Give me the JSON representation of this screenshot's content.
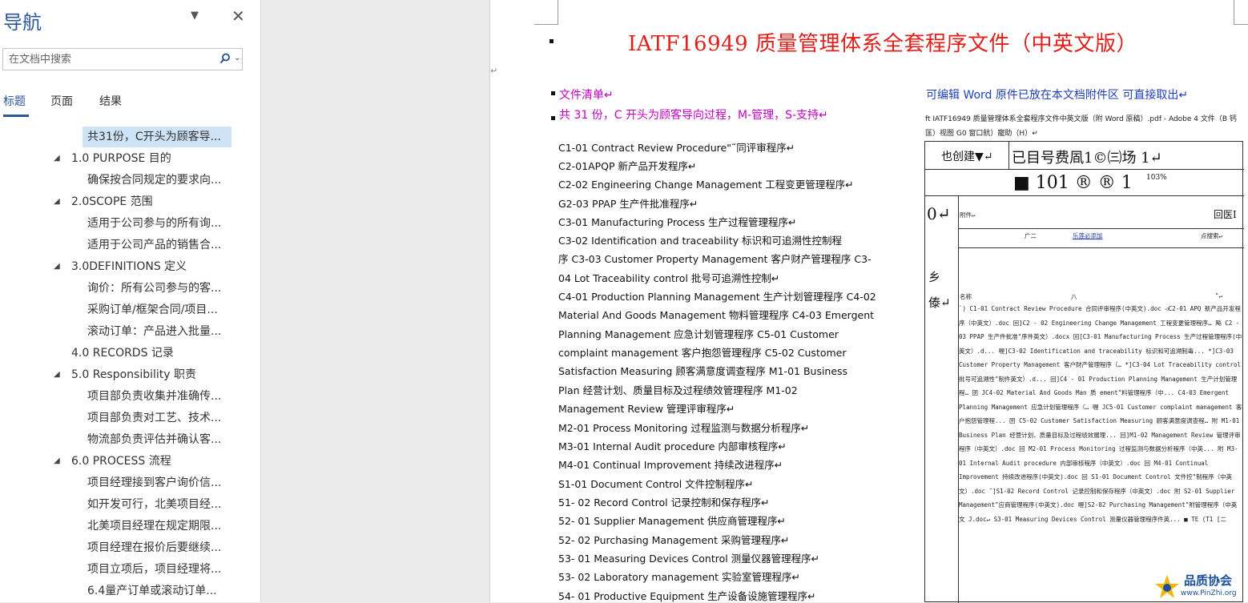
{
  "nav": {
    "title": "导航",
    "menu_icon": "triangle-down-icon",
    "close_icon": "close-icon",
    "search_placeholder": "在文档中搜索",
    "tabs": [
      "标题",
      "页面",
      "结果"
    ],
    "tree": [
      {
        "text": "共31份，C开头为顾客导...",
        "level": 2,
        "selected": true
      },
      {
        "text": "1.0 PURPOSE 目的",
        "level": 1,
        "expanded": true
      },
      {
        "text": "确保按合同规定的要求向...",
        "level": 2
      },
      {
        "text": "2.0SCOPE 范围",
        "level": 1,
        "expanded": true
      },
      {
        "text": "适用于公司参与的所有询...",
        "level": 2
      },
      {
        "text": "适用于公司产品的销售合...",
        "level": 2
      },
      {
        "text": "3.0DEFINITIONS 定义",
        "level": 1,
        "expanded": true
      },
      {
        "text": "询价：所有公司参与的客...",
        "level": 2
      },
      {
        "text": "采购订单/框架合同/项目...",
        "level": 2
      },
      {
        "text": "滚动订单：产品进入批量...",
        "level": 2
      },
      {
        "text": "4.0 RECORDS 记录",
        "level": 1
      },
      {
        "text": "5.0 Responsibility 职责",
        "level": 1,
        "expanded": true
      },
      {
        "text": "项目部负责收集并准确传...",
        "level": 2
      },
      {
        "text": "项目部负责对工艺、技术...",
        "level": 2
      },
      {
        "text": "物流部负责评估并确认客...",
        "level": 2
      },
      {
        "text": "6.0 PROCESS 流程",
        "level": 1,
        "expanded": true
      },
      {
        "text": "项目经理接到客户询价信...",
        "level": 2
      },
      {
        "text": "如开发可行，北美项目经...",
        "level": 2
      },
      {
        "text": "北美项目经理在规定期限...",
        "level": 2
      },
      {
        "text": "项目经理在报价后要继续...",
        "level": 2
      },
      {
        "text": "项目立项后，项目经理将...",
        "level": 2
      },
      {
        "text": "6.4量产订单或滚动订单...",
        "level": 2
      }
    ]
  },
  "doc": {
    "title": "IATF16949 质量管理体系全套程序文件（中英文版）",
    "file_list": "文件清单↵",
    "summary": "共 31 份，C 开头为顾客导向过程，M-管理，S-支持↵",
    "attach_note": "可编辑 Word 原件已放在本文档附件区 可直接取出↵",
    "pdf_caption": "ft IATF16949 质量管理体系全套程序文件中英文版（附 Word 原稿）.pdf - Adobe 4 文件（B 钙匡）视图 G0 窗口航）寵助（H）↵",
    "lines": [
      "C1-01 Contract Review Procedure\"˜同评审程序↵",
      "C2-01APQP 新产品开发程序↵",
      "C2-02 Engineering Change Management 工程变更管理程序↵",
      "G2-03 PPAP 生产件批准程序↵",
      "C3-01 Manufacturing Process 生产过程管理程序↵",
      "C3-02 Identification and traceability 标识和可追溯性控制程",
      "序 C3-03 Customer Property Management 客户财产管理程序 C3-",
      "04 Lot Traceability control 批号可追溯性控制↵",
      "C4-01 Production Planning Management 生产计划管理程序 C4-02",
      "Material And Goods Management 物料管理程序 C4-03 Emergent",
      "Planning Management 应急计划管理程序 C5-01 Customer",
      "complaint management 客户抱怨管理程序 C5-02 Customer",
      "Satisfaction Measuring 顾客满意度调查程序 M1-01 Business",
      "Plan 经营计划、质量目标及过程绩效管理程序 M1-02",
      "Management Review 管理评审程序↵",
      "M2-01 Process Monitoring 过程监测与数据分析程序↵",
      "M3-01 Internal Audit procedure 内部审核程序↵",
      "M4-01 Continual Improvement 持续改进程序↵",
      "S1-01 Document Control 文件控制程序↵",
      "51-  02 Record Control 记录控制和保存程序↵",
      "52-  01 Supplier Management 供应商管理程序↵",
      "52-  02 Purchasing Management 采购管理程序↵",
      "53-  01 Measuring Devices Control 测量仪器管理程序↵",
      "53-  02 Laboratory management 实验室管理程序↵",
      "54-  01 Productive Equipment 生产设备设施管理程序↵"
    ],
    "table": {
      "r1c1": "也创建▼↵",
      "r1c2": "已目号费凮1©㈢场 1↵",
      "r2": "■  101  ®  ®  1",
      "r2sup": "103%",
      "left_col": [
        "0↵",
        "乡",
        "傣↵"
      ],
      "attach_label": "附件↵",
      "attach_right": "回医I",
      "row3_a": "广二",
      "row3_b": "乐莲必添加",
      "row3_c": "点搜索↵",
      "name_hdr": "名称",
      "name_mid": "八",
      "name_end": "\"↵",
      "body": "`) C1-01 Contract Review Procedure 合同评审程序(中英文).doc ◁C2-01 APQ 新产品开发程序（中英文）.doc 回]C2 - 02 Engineering Change Management 工程变更管理程序… 飚 C2 - 03 PPAP 生产件批准\"序件英文）.docx 回[C3-01 Manufacturing Process 生产过程管理程序(中英文）.d... 喱]C3-02 Identification and traceability 标识和可追溯制毒... *]C3-03 Customer Property Management 客户财产管理程序（… *]C3-04 Lot Traceability control 批号可追溯性\"制件英文）.d... 回]C4 - 01 Production Planning Management 生产计划管理程… 囝 JC4-02 Material And Goods Man 质 ement\"料管理程序（中... C4-03 Emergent Planning Management 应急计划管理程序（… 喱 JC5-01 Customer complaint management 客户抱怨管理程... 囨 C5-02 Customer Satisfaction Measuring 顾客满意度调查程… 附 M1-01 Business Plan 经营计划、质量目标及过程绩效展理... 回]M1-02 Management Review 管理评审程序（中英文）.doc 回 M2-01 Process Monitoring 过程监测与数据分析程序（中英... 附 M3-01 Internal Audit procedure 内部审核程序（中英文）.doc 回 M4-01 Continual Improvement 持续改进程序(中英文).doc 回 S1-01 Document Control 文件控\"制程序（中英文）.doc ˜]S1-02 Record Control 记录控制和保存程序（中英文）.doc 附 S2-01 Supplier Management\"应商管理程序(中英文).doc 喱]S2-02 Purchasing Management\"附管理程序（中英文 J.doc↵ S3-01 Measuring Devices Control 测量仪器管理程序件英... ■ TE (T1 [二"
    },
    "logo": {
      "name": "品质协会",
      "url": "www.PinZhi.org"
    }
  }
}
